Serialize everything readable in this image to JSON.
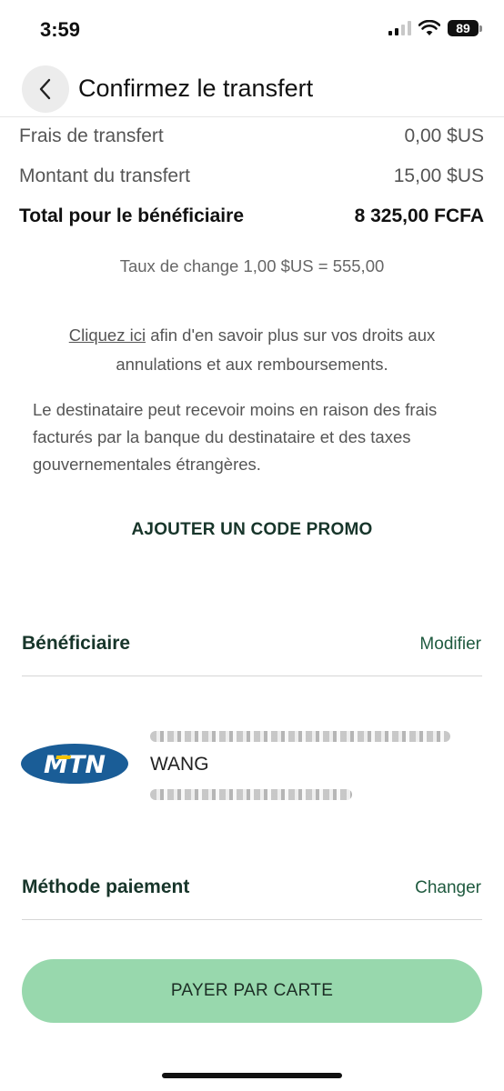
{
  "status_bar": {
    "time": "3:59",
    "battery": "89"
  },
  "header": {
    "title": "Confirmez le transfert",
    "back_icon": "chevron-left-icon"
  },
  "summary": {
    "fee_label": "Frais de transfert",
    "fee_value": "0,00 $US",
    "amount_label": "Montant du transfert",
    "amount_value": "15,00 $US",
    "total_label": "Total pour le bénéficiaire",
    "total_value": "8 325,00 FCFA",
    "exchange_rate": "Taux de change 1,00 $US = 555,00"
  },
  "info": {
    "link_text": "Cliquez ici",
    "link_rest": " afin d'en savoir plus sur vos droits aux annulations et aux remboursements.",
    "disclaimer": "Le destinataire peut recevoir moins en raison des frais facturés par la banque du destinataire et des taxes gouvernementales étrangères."
  },
  "promo": {
    "label": "AJOUTER UN CODE PROMO"
  },
  "beneficiary": {
    "title": "Bénéficiaire",
    "action": "Modifier",
    "provider_logo_text": "MTN",
    "name_visible": "WANG"
  },
  "payment": {
    "title": "Méthode paiement",
    "action": "Changer",
    "pay_button": "PAYER PAR CARTE"
  },
  "colors": {
    "accent_dark_green": "#17352a",
    "link_green": "#1f5a3f",
    "pay_button_bg": "#98d8ad",
    "mtn_blue": "#1a5d97",
    "mtn_yellow": "#f5c300"
  }
}
